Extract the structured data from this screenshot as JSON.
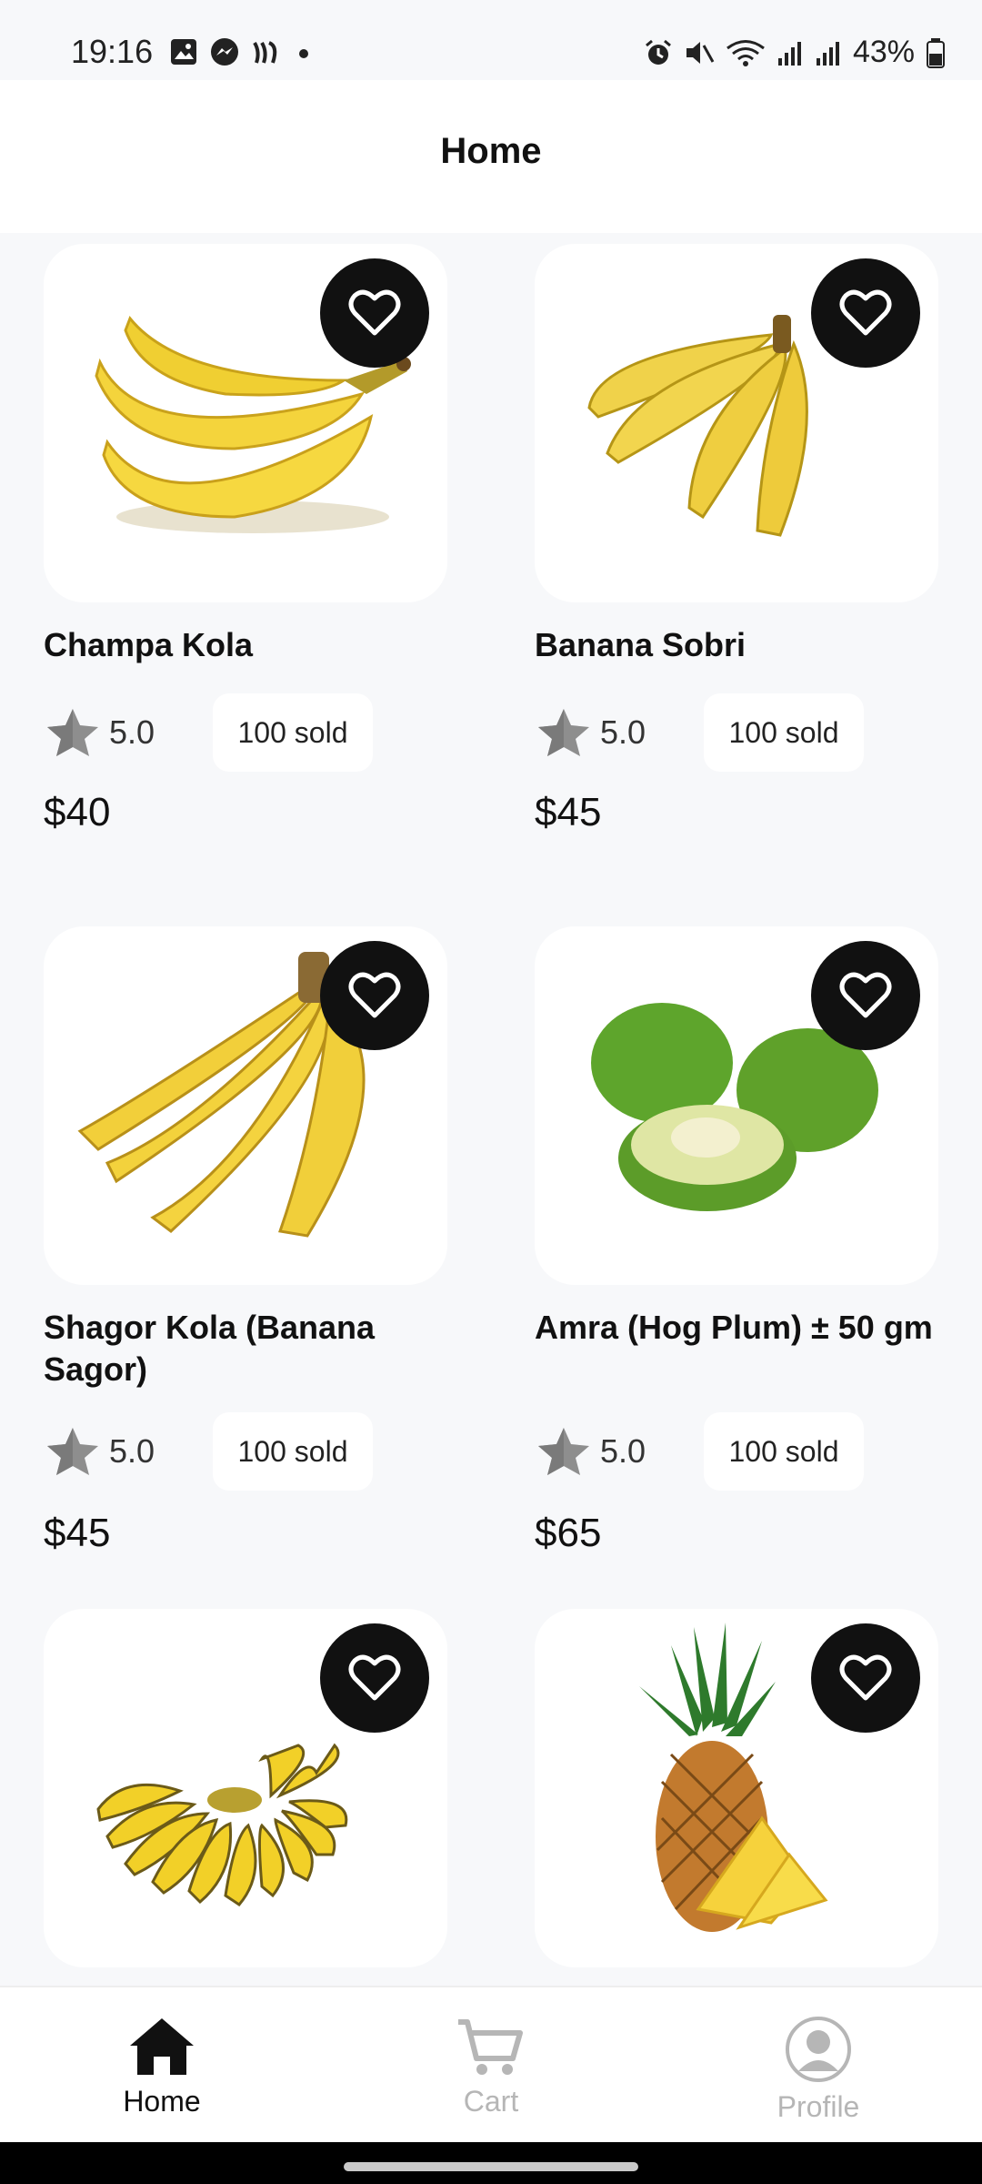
{
  "status_bar": {
    "time": "19:16",
    "battery": "43%"
  },
  "header": {
    "title": "Home"
  },
  "products": [
    {
      "name": "Champa Kola",
      "rating": "5.0",
      "sold": "100 sold",
      "price": "$40",
      "image": "banana-bunch-large"
    },
    {
      "name": "Banana Sobri",
      "rating": "5.0",
      "sold": "100 sold",
      "price": "$45",
      "image": "banana-small-bunch"
    },
    {
      "name": "Shagor Kola (Banana Sagor)",
      "rating": "5.0",
      "sold": "100 sold",
      "price": "$45",
      "image": "banana-bunch"
    },
    {
      "name": "Amra (Hog Plum) ± 50 gm",
      "rating": "5.0",
      "sold": "100 sold",
      "price": "$65",
      "image": "hog-plum"
    },
    {
      "name": "",
      "rating": "",
      "sold": "",
      "price": "",
      "image": "baby-banana-hand"
    },
    {
      "name": "",
      "rating": "",
      "sold": "",
      "price": "",
      "image": "pineapple"
    }
  ],
  "nav": [
    {
      "label": "Home",
      "icon": "home-icon",
      "active": true
    },
    {
      "label": "Cart",
      "icon": "cart-icon",
      "active": false
    },
    {
      "label": "Profile",
      "icon": "profile-icon",
      "active": false
    }
  ],
  "colors": {
    "accent": "#111111",
    "background": "#f7f8fa",
    "inactive": "#b6b6b6",
    "star": "#8e8e8e"
  }
}
